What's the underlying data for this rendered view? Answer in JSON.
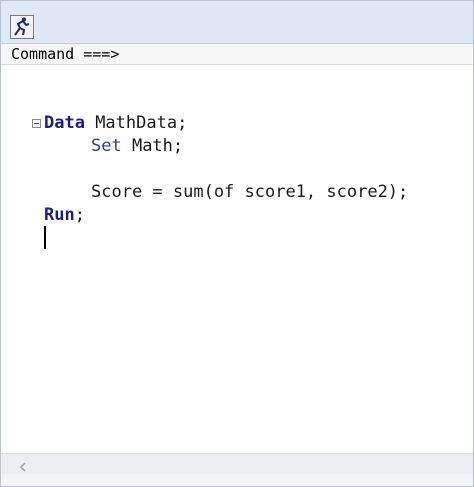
{
  "titlebar": {
    "icon": "run-program-icon"
  },
  "command_bar": {
    "label": "Command ===>"
  },
  "editor": {
    "lines": [
      {
        "keyword": "Data",
        "rest": " MathData;"
      },
      {
        "keyword": "Set",
        "rest": " Math;"
      },
      {
        "text": "Score = sum(of score1, score2);"
      },
      {
        "keyword": "Run",
        "rest": ";"
      }
    ]
  },
  "scrollbar": {
    "left_arrow_icon": "chevron-left-icon"
  }
}
